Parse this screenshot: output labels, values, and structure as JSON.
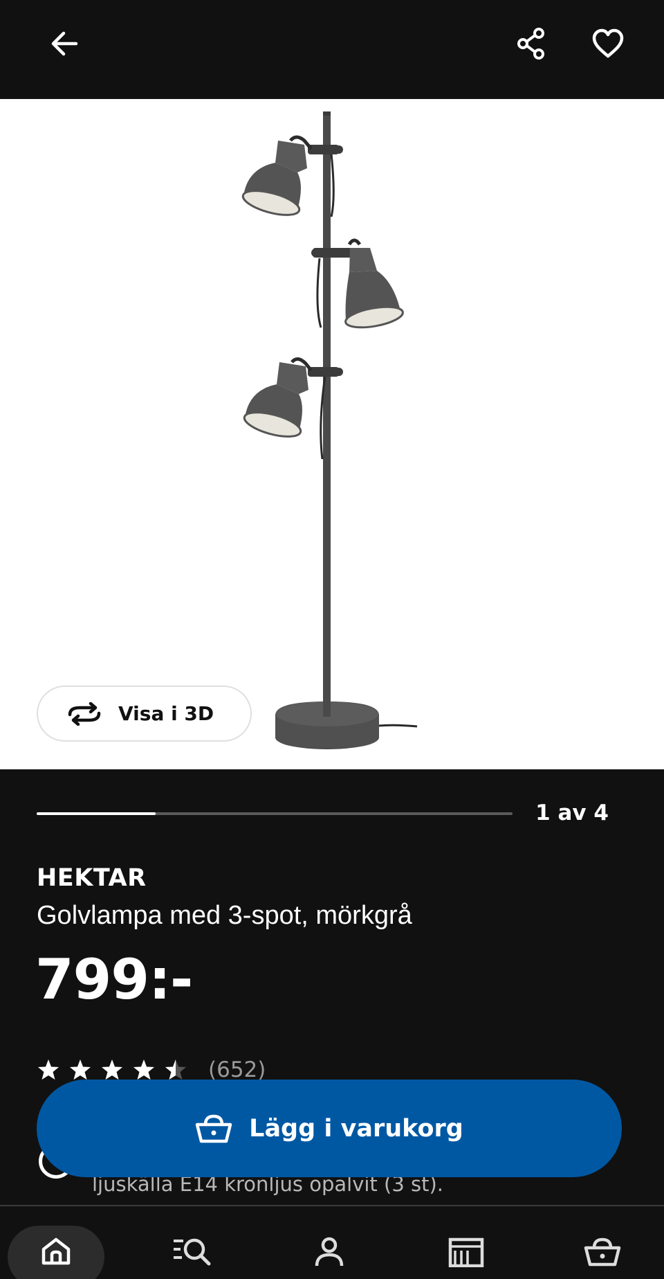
{
  "header": {
    "back_icon": "arrow-left-icon",
    "share_icon": "share-icon",
    "favorite_icon": "heart-icon"
  },
  "gallery": {
    "view_3d_label": "Visa i 3D",
    "view_3d_icon": "rotate-3d-icon",
    "counter": "1 av 4",
    "progress_fraction": 0.25
  },
  "product": {
    "name": "HEKTAR",
    "description": "Golvlampa med 3-spot, mörkgrå",
    "price": "799:-",
    "rating": 4.5,
    "reviews": "(652)",
    "bundle_text": "ljuskälla E14 kronljus opalvit (3 st)."
  },
  "cta": {
    "label": "Lägg i varukorg",
    "icon": "basket-icon",
    "color": "#0058a3"
  },
  "nav": {
    "items": [
      {
        "icon": "home-icon",
        "active": true
      },
      {
        "icon": "search-list-icon"
      },
      {
        "icon": "user-icon"
      },
      {
        "icon": "store-icon"
      },
      {
        "icon": "basket-icon"
      }
    ]
  }
}
